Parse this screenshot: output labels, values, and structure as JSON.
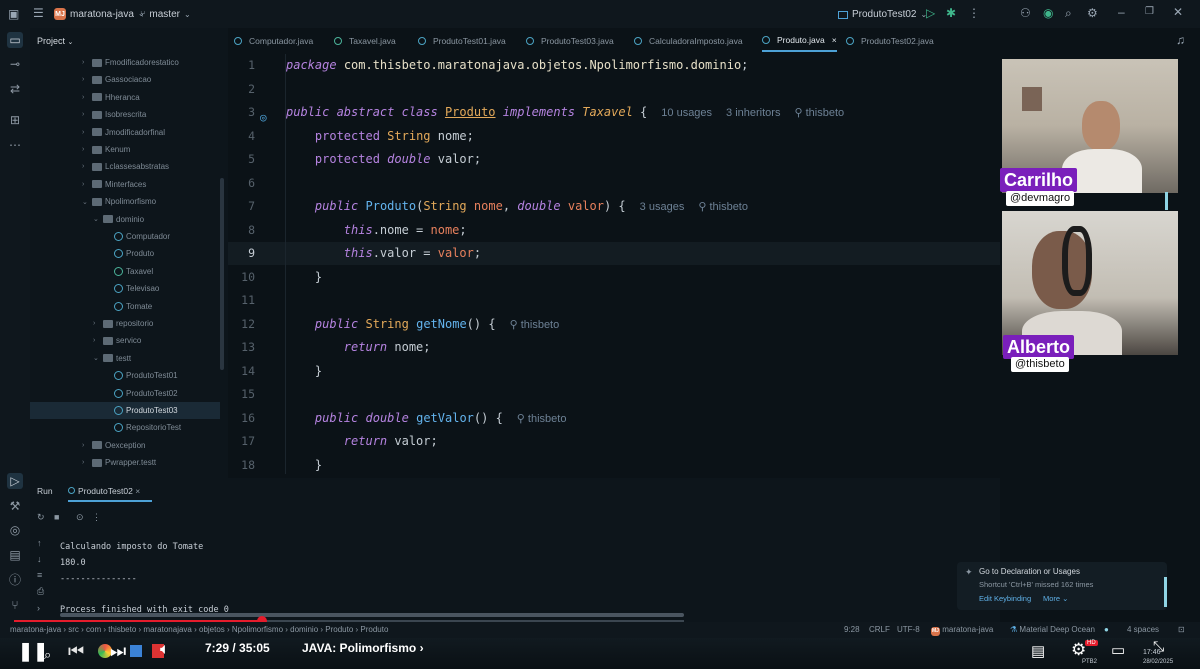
{
  "topbar": {
    "project_badge": "MJ",
    "project": "maratona-java",
    "branch": "master",
    "run_config": "ProdutoTest02"
  },
  "project_panel": {
    "title": "Project",
    "items": [
      {
        "label": "Fmodificadorestatico",
        "type": "folder",
        "depth": 0
      },
      {
        "label": "Gassociacao",
        "type": "folder",
        "depth": 0
      },
      {
        "label": "Hheranca",
        "type": "folder",
        "depth": 0
      },
      {
        "label": "Isobrescrita",
        "type": "folder",
        "depth": 0
      },
      {
        "label": "Jmodificadorfinal",
        "type": "folder",
        "depth": 0
      },
      {
        "label": "Kenum",
        "type": "folder",
        "depth": 0
      },
      {
        "label": "Lclassesabstratas",
        "type": "folder",
        "depth": 0
      },
      {
        "label": "Minterfaces",
        "type": "folder",
        "depth": 0
      },
      {
        "label": "Npolimorfismo",
        "type": "folder",
        "depth": 0,
        "open": true
      },
      {
        "label": "dominio",
        "type": "folder",
        "depth": 1,
        "open": true
      },
      {
        "label": "Computador",
        "type": "class",
        "depth": 2
      },
      {
        "label": "Produto",
        "type": "class",
        "depth": 2
      },
      {
        "label": "Taxavel",
        "type": "interface",
        "depth": 2
      },
      {
        "label": "Televisao",
        "type": "class",
        "depth": 2
      },
      {
        "label": "Tomate",
        "type": "class",
        "depth": 2
      },
      {
        "label": "repositorio",
        "type": "folder",
        "depth": 1
      },
      {
        "label": "servico",
        "type": "folder",
        "depth": 1
      },
      {
        "label": "testt",
        "type": "folder",
        "depth": 1,
        "open": true
      },
      {
        "label": "ProdutoTest01",
        "type": "class",
        "depth": 2
      },
      {
        "label": "ProdutoTest02",
        "type": "class",
        "depth": 2
      },
      {
        "label": "ProdutoTest03",
        "type": "class",
        "depth": 2,
        "selected": true
      },
      {
        "label": "RepositorioTest",
        "type": "class",
        "depth": 2
      },
      {
        "label": "Oexception",
        "type": "folder",
        "depth": 0
      },
      {
        "label": "Pwrapper.testt",
        "type": "folder",
        "depth": 0
      }
    ]
  },
  "tabs": [
    {
      "label": "Computador.java",
      "active": false
    },
    {
      "label": "Taxavel.java",
      "active": false
    },
    {
      "label": "ProdutoTest01.java",
      "active": false
    },
    {
      "label": "ProdutoTest03.java",
      "active": false
    },
    {
      "label": "CalculadoraImposto.java",
      "active": false
    },
    {
      "label": "Produto.java",
      "active": true,
      "close": "×"
    },
    {
      "label": "ProdutoTest02.java",
      "active": false
    }
  ],
  "editor": {
    "line_numbers": [
      "1",
      "2",
      "3",
      "4",
      "5",
      "6",
      "7",
      "8",
      "9",
      "10",
      "11",
      "12",
      "13",
      "14",
      "15",
      "16",
      "17",
      "18"
    ],
    "current_line": 9,
    "hints": {
      "class_usages": "10 usages",
      "class_inheritors": "3 inheritors",
      "author": "thisbeto",
      "ctor_usages": "3 usages"
    }
  },
  "webcams": [
    {
      "name": "Carrilho",
      "handle": "@devmagro"
    },
    {
      "name": "Alberto",
      "handle": "@thisbeto"
    }
  ],
  "bottom_panel": {
    "run_tab": "Run",
    "config_tab": "ProdutoTest02",
    "config_close": "×",
    "output": [
      "Calculando imposto do Tomate",
      "180.0",
      "---------------",
      "",
      "Process finished with exit code 0"
    ]
  },
  "notification": {
    "title": "Go to Declaration or Usages",
    "body": "Shortcut 'Ctrl+B' missed 162 times",
    "action1": "Edit Keybinding",
    "action2": "More"
  },
  "statusbar": {
    "breadcrumb": [
      "maratona-java",
      "src",
      "com",
      "thisbeto",
      "maratonajava",
      "objetos",
      "Npolimorfismo",
      "dominio",
      "Produto",
      "Produto"
    ],
    "position": "9:28",
    "line_sep": "CRLF",
    "encoding": "UTF-8",
    "project": "maratona-java",
    "theme": "Material Deep Ocean",
    "indent": "4 spaces"
  },
  "player": {
    "time": "7:29 / 35:05",
    "chapter": "JAVA: Polimorfismo",
    "progress_fraction": 0.37,
    "lang": "PTB2",
    "date": "28/02/2025",
    "clock": "17:46",
    "hd": "HD"
  }
}
